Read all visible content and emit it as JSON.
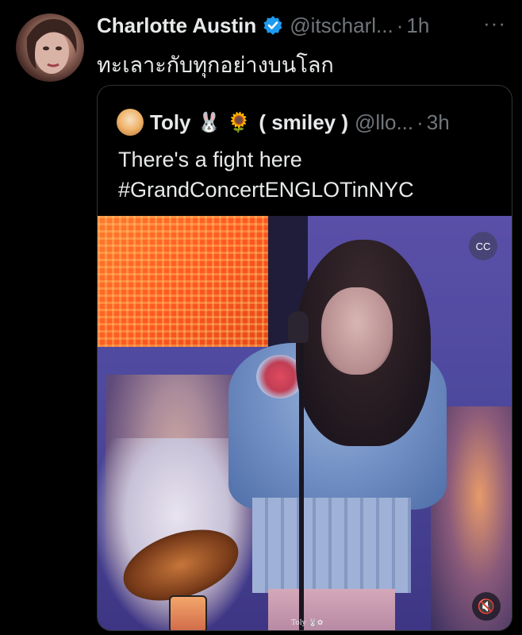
{
  "author": {
    "display_name": "Charlotte Austin",
    "handle": "@itscharl...",
    "separator": "·",
    "time": "1h",
    "verified": true,
    "avatar_icon": "profile-photo"
  },
  "post": {
    "text": "ทะเลาะกับทุกอย่างบนโลก",
    "more_label": "···"
  },
  "quote": {
    "display_name": "Toly",
    "emoji_1": "🐰",
    "emoji_2": "🌻",
    "name_suffix": "( smiley )",
    "handle": "@llo...",
    "separator": "·",
    "time": "3h",
    "line_1": "There's a fight here",
    "line_2": "#GrandConcertENGLOTinNYC",
    "media": {
      "type": "video",
      "captions_icon": "captions-icon",
      "captions_label": "CC",
      "mute_icon": "speaker-muted-icon",
      "mute_label": "🔇",
      "watermark": "Toly 🐰✿"
    }
  },
  "colors": {
    "background": "#000000",
    "text_primary": "#e7e9ea",
    "text_secondary": "#71767b",
    "border": "#2f3336",
    "verified_blue": "#1d9bf0"
  }
}
